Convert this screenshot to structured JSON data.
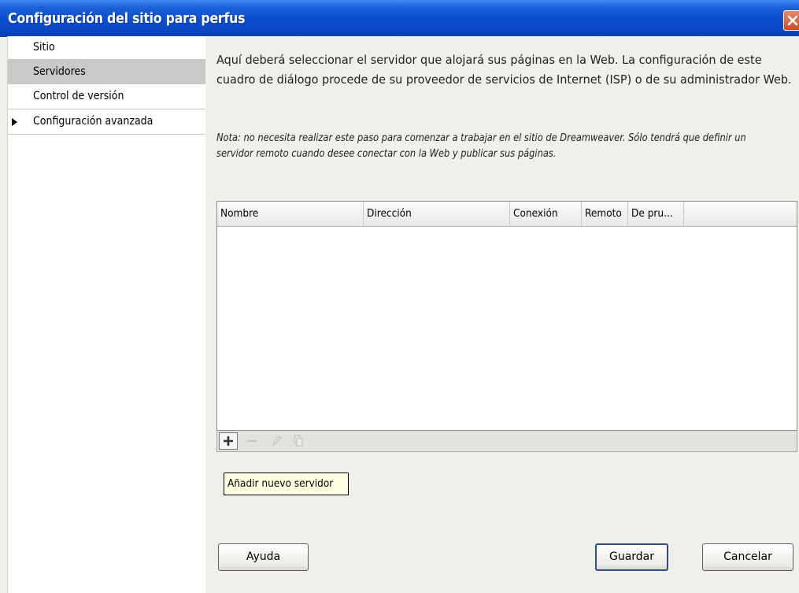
{
  "window": {
    "title": "Configuración del sitio para perfus"
  },
  "sidebar": {
    "items": [
      {
        "label": "Sitio",
        "selected": false,
        "expandable": false
      },
      {
        "label": "Servidores",
        "selected": true,
        "expandable": false
      },
      {
        "label": "Control de versión",
        "selected": false,
        "expandable": false
      },
      {
        "label": "Configuración avanzada",
        "selected": false,
        "expandable": true
      }
    ]
  },
  "main": {
    "description": "Aquí deberá seleccionar el servidor que alojará sus páginas en la Web. La configuración de este cuadro de diálogo procede de su proveedor de servicios de Internet (ISP) o de su administrador Web.",
    "note": "Nota: no necesita realizar este paso para comenzar a trabajar en el sitio de Dreamweaver. Sólo tendrá que definir un servidor remoto cuando desee conectar con la Web y publicar sus páginas.",
    "table": {
      "columns": [
        "Nombre",
        "Dirección",
        "Conexión",
        "Remoto",
        "De pru..."
      ],
      "rows": []
    },
    "toolbar": {
      "icons": [
        "plus-icon",
        "minus-icon",
        "pencil-icon",
        "duplicate-icon"
      ]
    },
    "tooltip": "Añadir nuevo servidor"
  },
  "buttons": {
    "help": "Ayuda",
    "save": "Guardar",
    "cancel": "Cancelar"
  },
  "colors": {
    "titlebar": "#0a4fd0",
    "close": "#d24c23",
    "selected_item": "#c9c9c9",
    "tooltip_bg": "#ffffe1"
  }
}
